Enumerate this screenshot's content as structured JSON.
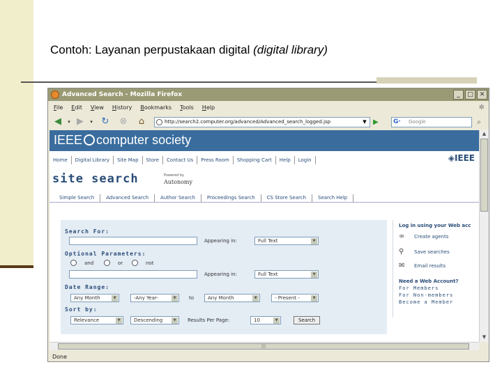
{
  "slide": {
    "title_main": "Contoh: Layanan perpustakaan digital ",
    "title_italic": "(digital library)"
  },
  "browser": {
    "window_title": "Advanced Search - Mozilla Firefox",
    "menu": [
      "File",
      "Edit",
      "View",
      "History",
      "Bookmarks",
      "Tools",
      "Help"
    ],
    "url": "http://search2.computer.org/advanced/Advanced_search_logged.jsp",
    "search_placeholder": "Google",
    "status": "Done"
  },
  "site": {
    "brand": "computer society",
    "brand_prefix": "IEEE",
    "top_nav": [
      "Home",
      "Digital Library",
      "Site Map",
      "Store",
      "Contact Us",
      "Press Room",
      "Shopping Cart",
      "Help",
      "Login"
    ],
    "ieee_mark": "IEEE",
    "search_title": "site search",
    "powered_by": "Powered by",
    "autonomy": "Autonomy",
    "sub_nav": [
      "Simple Search",
      "Advanced Search",
      "Author Search",
      "Proceedings Search",
      "CS Store Search",
      "Search Help"
    ]
  },
  "form": {
    "search_for_label": "Search For:",
    "appearing_in_label": "Appearing in:",
    "appearing_in_value": "Full Text",
    "optional_label": "Optional Parameters:",
    "radio_and": "and",
    "radio_or": "or",
    "radio_not": "not",
    "appearing_in_label_2": "Appearing in:",
    "appearing_in_value_2": "Full Text",
    "date_range_label": "Date Range:",
    "from_month": "Any Month",
    "from_year": "-Any Year-",
    "to_label": "to",
    "to_month": "Any Month",
    "to_year": "- Present -",
    "sort_label": "Sort by:",
    "sort_value": "Relevance",
    "order_value": "Descending",
    "per_page_label": "Results Per Page:",
    "per_page_value": "10",
    "search_button": "Search"
  },
  "side": {
    "title": "Log in using your Web acc",
    "create_agents": "Create agents",
    "save_searches": "Save searches",
    "email_results": "Email results",
    "need_account": "Need a Web Account?",
    "for_members": "For Members",
    "for_non_members": "For Non-members",
    "become_member": "Become a Member"
  }
}
